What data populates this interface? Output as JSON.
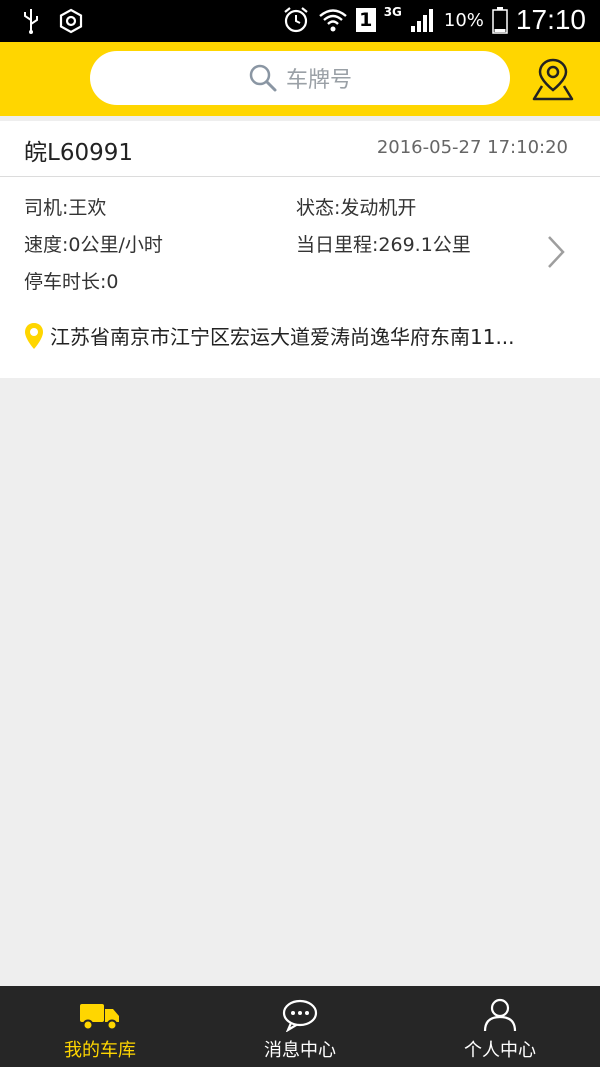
{
  "status_bar": {
    "battery": "10%",
    "network": "3G",
    "sim": "1",
    "time": "17:10"
  },
  "search": {
    "placeholder": "车牌号"
  },
  "vehicle": {
    "plate": "皖L60991",
    "timestamp": "2016-05-27 17:10:20",
    "driver": "司机:王欢",
    "status": "状态:发动机开",
    "speed": "速度:0公里/小时",
    "mileage": "当日里程:269.1公里",
    "parking": "停车时长:0",
    "address": "江苏省南京市江宁区宏运大道爱涛尚逸华府东南11..."
  },
  "tabs": [
    {
      "label": "我的车库",
      "icon": "truck-icon",
      "active": true
    },
    {
      "label": "消息中心",
      "icon": "chat-icon",
      "active": false
    },
    {
      "label": "个人中心",
      "icon": "person-icon",
      "active": false
    }
  ],
  "colors": {
    "accent": "#FFD600",
    "tab_active": "#FFD600",
    "tab_inactive": "#FFFFFF",
    "tabbar_bg": "#262626"
  }
}
